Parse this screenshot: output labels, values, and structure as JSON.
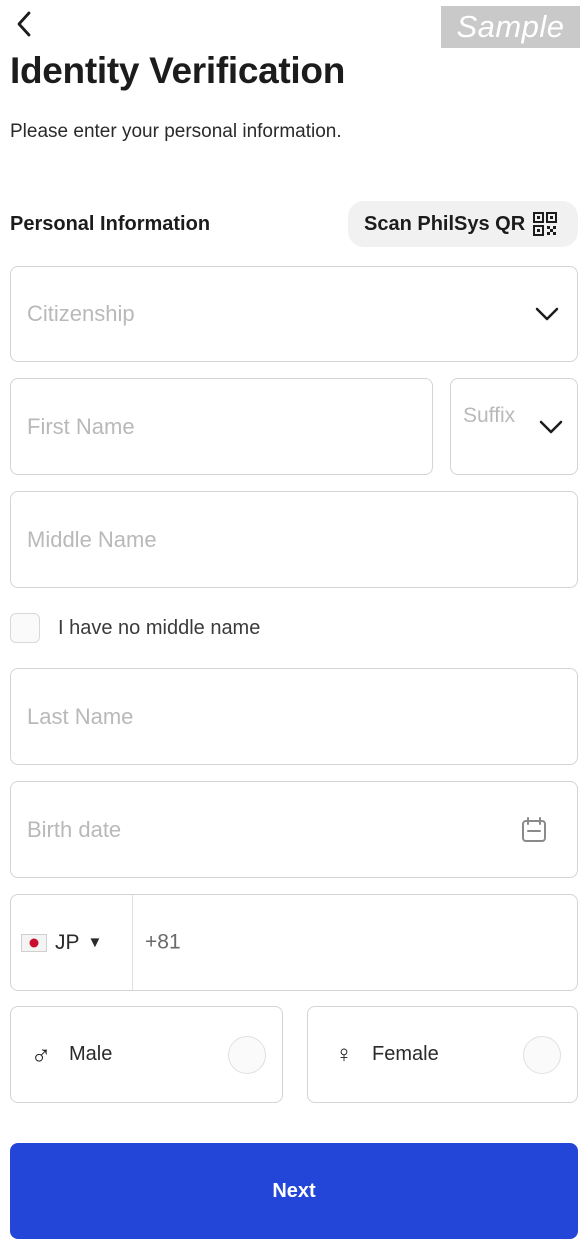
{
  "header": {
    "back_icon": "chevron-left-icon",
    "watermark": "Sample",
    "title": "Identity Verification",
    "subtitle": "Please enter your personal information."
  },
  "section": {
    "title": "Personal Information",
    "scan_label": "Scan PhilSys QR",
    "scan_icon": "qr-code-icon"
  },
  "form": {
    "citizenship_placeholder": "Citizenship",
    "first_name_placeholder": "First Name",
    "suffix_placeholder": "Suffix",
    "middle_name_placeholder": "Middle Name",
    "no_middle_name_label": "I have no middle name",
    "no_middle_name_checked": false,
    "last_name_placeholder": "Last Name",
    "birth_date_placeholder": "Birth date",
    "phone": {
      "country_code": "JP",
      "caret": "▼",
      "dial_code": "+81"
    },
    "gender": {
      "male_label": "Male",
      "male_symbol": "♂",
      "female_label": "Female",
      "female_symbol": "♀"
    }
  },
  "actions": {
    "next_label": "Next"
  },
  "colors": {
    "primary": "#2346d8",
    "border": "#d4d4d4",
    "placeholder": "#b9b9b9"
  }
}
